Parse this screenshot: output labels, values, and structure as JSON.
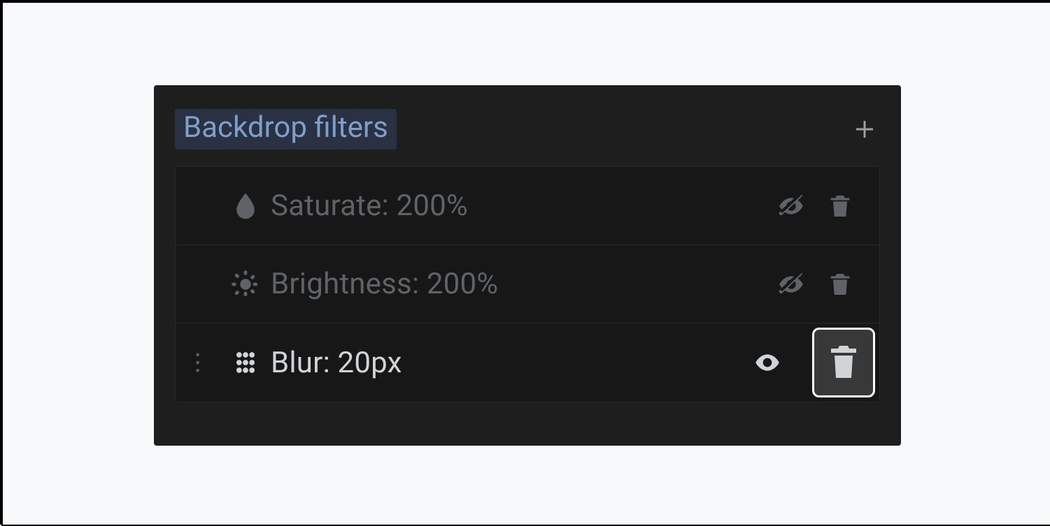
{
  "panel": {
    "title": "Backdrop filters"
  },
  "filters": [
    {
      "label": "Saturate: 200%"
    },
    {
      "label": "Brightness: 200%"
    },
    {
      "label": "Blur: 20px"
    }
  ]
}
